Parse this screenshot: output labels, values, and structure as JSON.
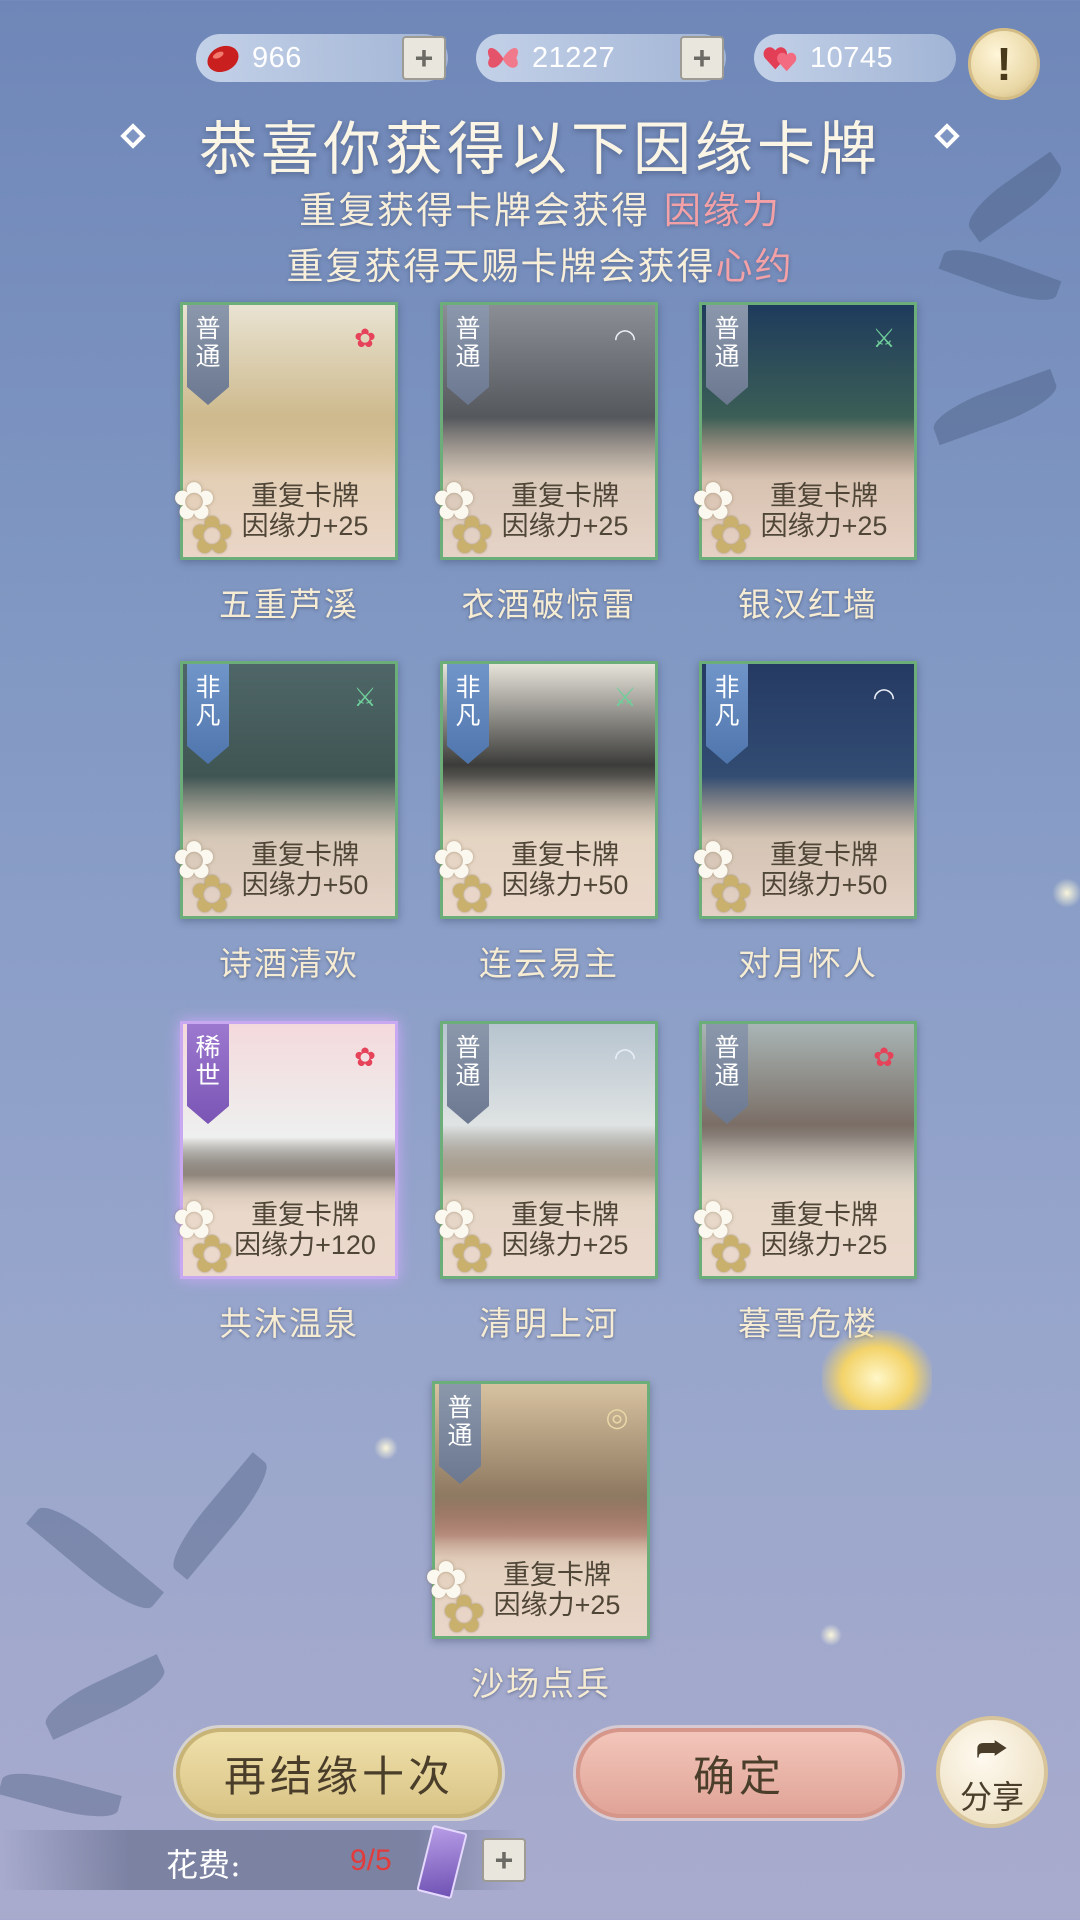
{
  "resources": [
    {
      "name": "red-bean",
      "icon": "red-bean-icon",
      "value": "966",
      "has_plus": true
    },
    {
      "name": "butterfly",
      "icon": "butterfly-icon",
      "value": "21227",
      "has_plus": true
    },
    {
      "name": "hearts",
      "icon": "hearts-icon",
      "value": "10745",
      "has_plus": false
    }
  ],
  "header": {
    "title": "恭喜你获得以下因缘卡牌",
    "line1_prefix": "重复获得卡牌会获得",
    "line1_highlight": "因缘力",
    "line2_prefix": "重复获得天赐卡牌会获得",
    "line2_highlight": "心约"
  },
  "cards": [
    {
      "rarity": [
        "普",
        "通"
      ],
      "rarity_type": "common",
      "dup_line1": "重复卡牌",
      "dup_line2": "因缘力+25",
      "name": "五重芦溪",
      "icon": "plum-blossom-icon"
    },
    {
      "rarity": [
        "普",
        "通"
      ],
      "rarity_type": "common",
      "dup_line1": "重复卡牌",
      "dup_line2": "因缘力+25",
      "name": "衣酒破惊雷",
      "icon": "fan-icon"
    },
    {
      "rarity": [
        "普",
        "通"
      ],
      "rarity_type": "common",
      "dup_line1": "重复卡牌",
      "dup_line2": "因缘力+25",
      "name": "银汉红墙",
      "icon": "sword-icon"
    },
    {
      "rarity": [
        "非",
        "凡"
      ],
      "rarity_type": "extraordinary",
      "dup_line1": "重复卡牌",
      "dup_line2": "因缘力+50",
      "name": "诗酒清欢",
      "icon": "sword-icon"
    },
    {
      "rarity": [
        "非",
        "凡"
      ],
      "rarity_type": "extraordinary",
      "dup_line1": "重复卡牌",
      "dup_line2": "因缘力+50",
      "name": "连云易主",
      "icon": "sword-icon"
    },
    {
      "rarity": [
        "非",
        "凡"
      ],
      "rarity_type": "extraordinary",
      "dup_line1": "重复卡牌",
      "dup_line2": "因缘力+50",
      "name": "对月怀人",
      "icon": "fan-icon"
    },
    {
      "rarity": [
        "稀",
        "世"
      ],
      "rarity_type": "rare",
      "dup_line1": "重复卡牌",
      "dup_line2": "因缘力+120",
      "name": "共沐温泉",
      "icon": "plum-blossom-icon"
    },
    {
      "rarity": [
        "普",
        "通"
      ],
      "rarity_type": "common",
      "dup_line1": "重复卡牌",
      "dup_line2": "因缘力+25",
      "name": "清明上河",
      "icon": "fan-icon"
    },
    {
      "rarity": [
        "普",
        "通"
      ],
      "rarity_type": "common",
      "dup_line1": "重复卡牌",
      "dup_line2": "因缘力+25",
      "name": "暮雪危楼",
      "icon": "plum-blossom-icon"
    },
    {
      "rarity": [
        "普",
        "通"
      ],
      "rarity_type": "common",
      "dup_line1": "重复卡牌",
      "dup_line2": "因缘力+25",
      "name": "沙场点兵",
      "icon": "shield-icon"
    }
  ],
  "buttons": {
    "again": "再结缘十次",
    "confirm": "确定",
    "share": "分享"
  },
  "cost": {
    "label": "花费:",
    "amount": "9/5"
  },
  "colors": {
    "highlight": "#f3a1a7",
    "cost_red": "#e23b3b",
    "common_ribbon": "#7b879d",
    "extraordinary_ribbon": "#5f85bd",
    "rare_ribbon": "#8a66c2"
  }
}
